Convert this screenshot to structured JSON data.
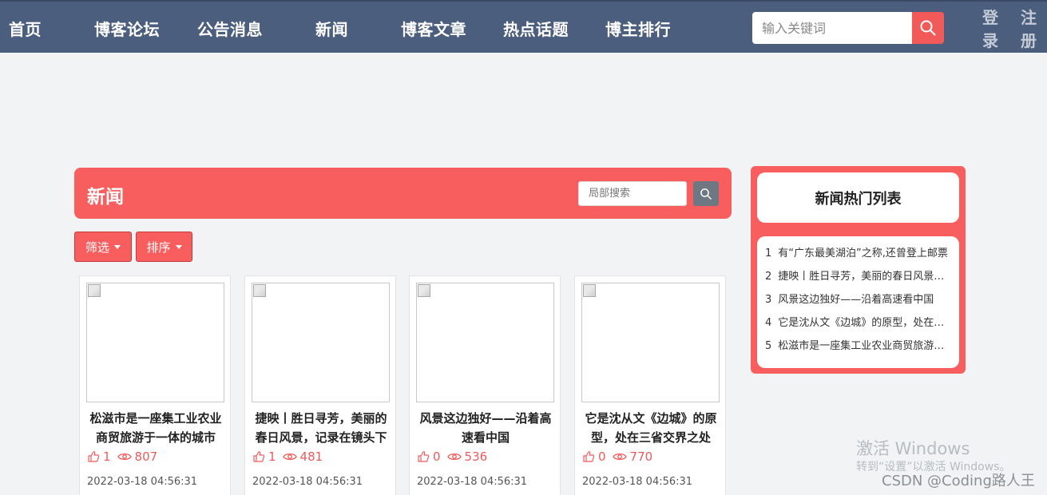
{
  "nav": {
    "items": [
      "首页",
      "博客论坛",
      "公告消息",
      "新闻",
      "博客文章",
      "热点话题",
      "博主排行"
    ],
    "search_placeholder": "输入关键词",
    "login_top": "登",
    "login_bottom": "录",
    "register_top": "注",
    "register_bottom": "册"
  },
  "main": {
    "title": "新闻",
    "local_search_placeholder": "局部搜索",
    "filter_label": "筛选",
    "sort_label": "排序"
  },
  "cards": [
    {
      "title": "松滋市是一座集工业农业商贸旅游于一体的城市",
      "likes": "1",
      "views": "807",
      "date": "2022-03-18 04:56:31"
    },
    {
      "title": "捷映丨胜日寻芳，美丽的春日风景，记录在镜头下",
      "likes": "1",
      "views": "481",
      "date": "2022-03-18 04:56:31"
    },
    {
      "title": "风景这边独好——沿着高速看中国",
      "likes": "0",
      "views": "536",
      "date": "2022-03-18 04:56:31"
    },
    {
      "title": "它是沈从文《边城》的原型，处在三省交界之处",
      "likes": "0",
      "views": "770",
      "date": "2022-03-18 04:56:31"
    }
  ],
  "sidebar": {
    "title": "新闻热门列表",
    "items": [
      {
        "num": "1",
        "text": "有“广东最美湖泊”之称,还曾登上邮票"
      },
      {
        "num": "2",
        "text": "捷映丨胜日寻芳，美丽的春日风景，记录在镜头下"
      },
      {
        "num": "3",
        "text": "风景这边独好——沿着高速看中国"
      },
      {
        "num": "4",
        "text": "它是沈从文《边城》的原型，处在三省交界之处"
      },
      {
        "num": "5",
        "text": "松滋市是一座集工业农业商贸旅游于一体的城市"
      }
    ]
  },
  "watermark": {
    "title": "激活 Windows",
    "subtitle": "转到“设置”以激活 Windows。",
    "credit": "CSDN @Coding路人王"
  },
  "colors": {
    "nav_bg": "#4c5e7e",
    "accent": "#f85e5e",
    "page_bg": "#f1f3f4"
  }
}
